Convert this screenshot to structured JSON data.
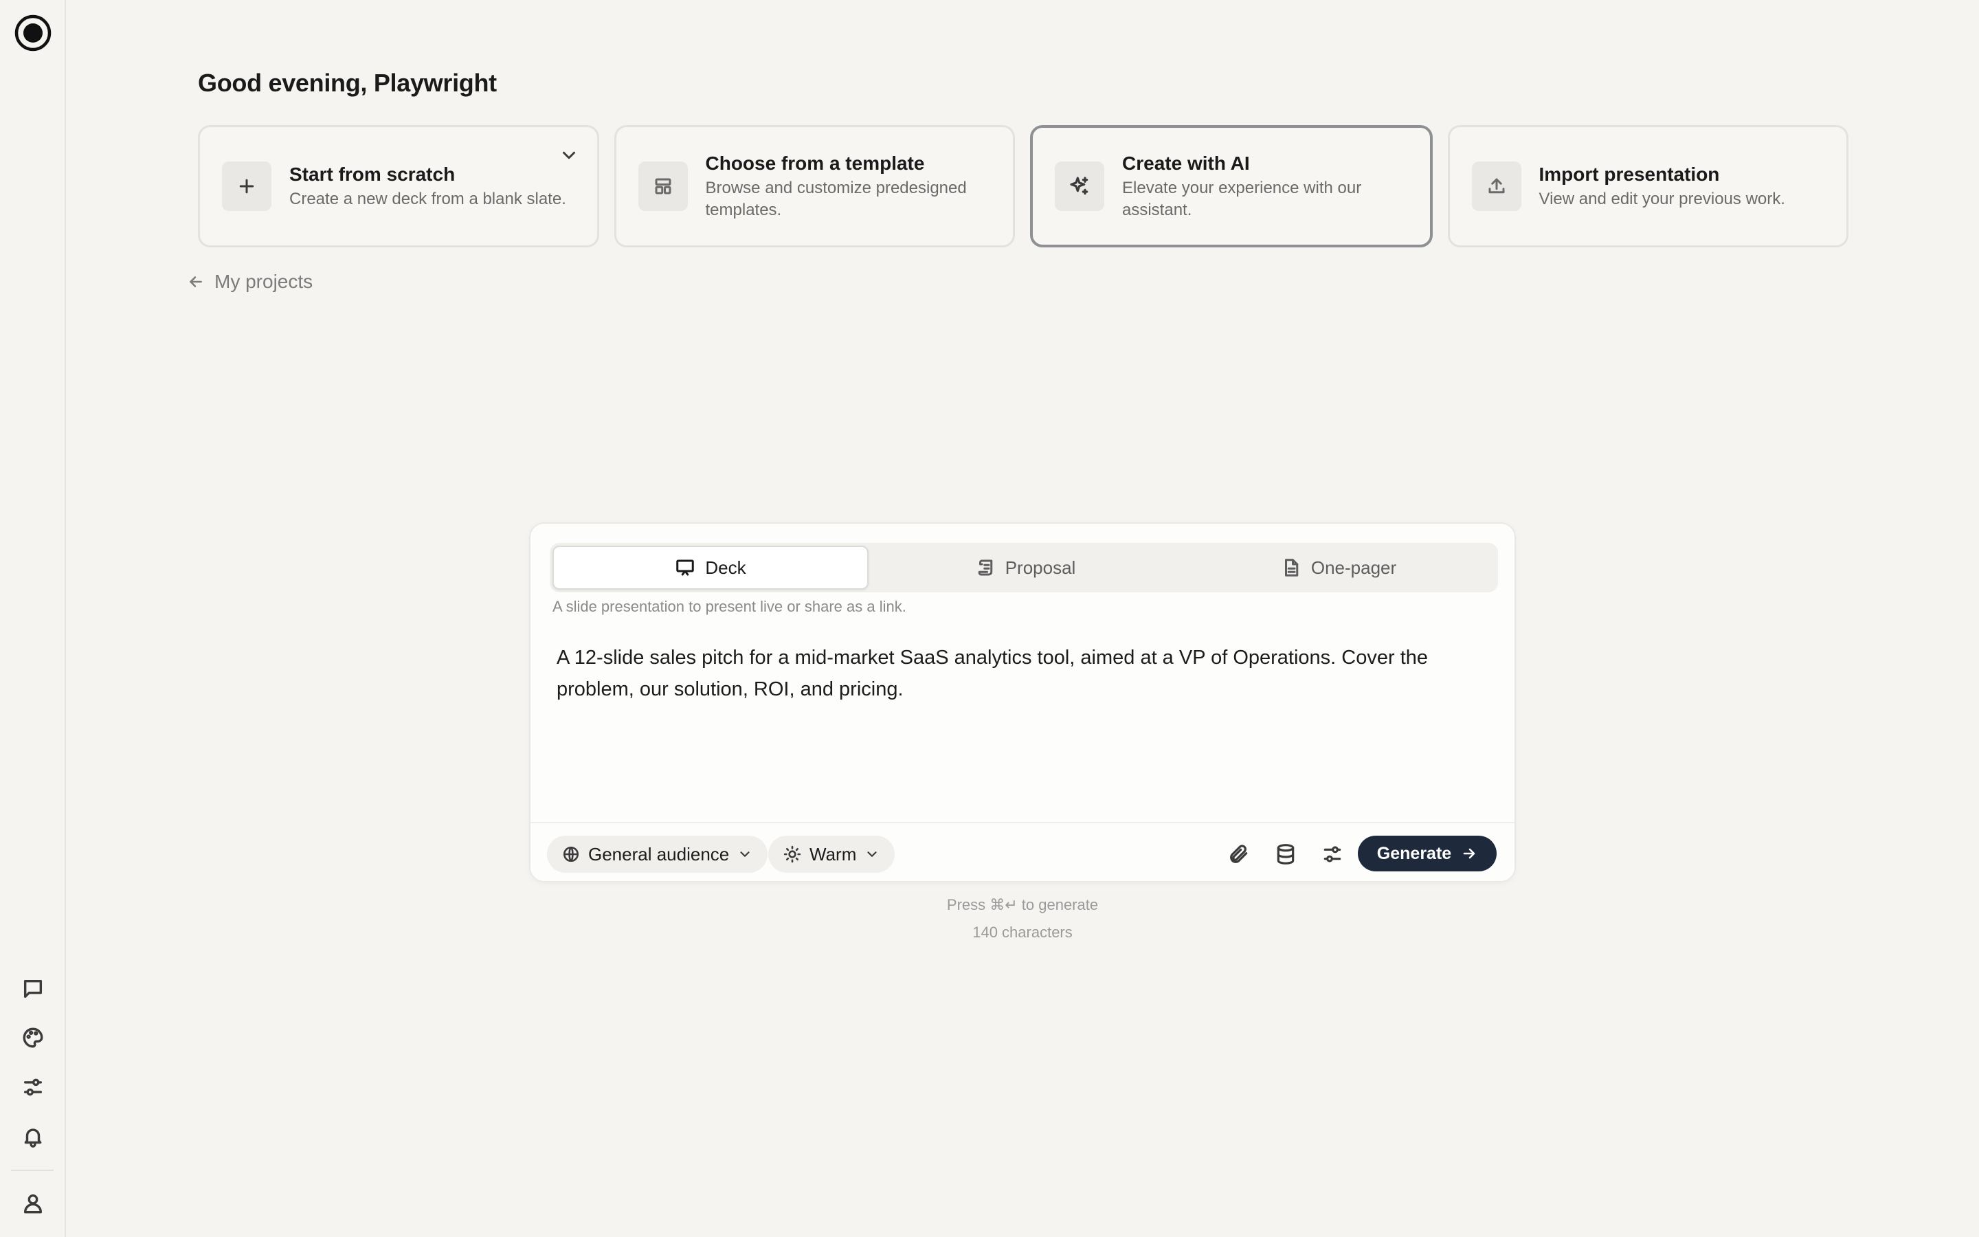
{
  "greeting": "Good evening, Playwright",
  "cards": [
    {
      "title": "Start from scratch",
      "desc": "Create a new deck from a blank slate.",
      "icon": "plus-icon"
    },
    {
      "title": "Choose from a template",
      "desc": "Browse and customize predesigned templates.",
      "icon": "template-icon"
    },
    {
      "title": "Create with AI",
      "desc": "Elevate your experience with our assistant.",
      "icon": "sparkle-icon",
      "selected": true
    },
    {
      "title": "Import presentation",
      "desc": "View and edit your previous work.",
      "icon": "upload-icon"
    }
  ],
  "back_link": "My projects",
  "composer": {
    "tabs": [
      {
        "label": "Deck",
        "icon": "presentation-icon",
        "active": true
      },
      {
        "label": "Proposal",
        "icon": "scroll-icon"
      },
      {
        "label": "One-pager",
        "icon": "document-icon"
      }
    ],
    "tab_description": "A slide presentation to present live or share as a link.",
    "prompt": "A 12-slide sales pitch for a mid-market SaaS analytics tool, aimed at a VP of Operations. Cover the problem, our solution, ROI, and pricing.",
    "audience": "General audience",
    "tone": "Warm",
    "generate_label": "Generate"
  },
  "hints": {
    "shortcut": "Press ⌘↵ to generate",
    "count": "140 characters"
  },
  "colors": {
    "background": "#f5f4f1",
    "generate_button": "#1e2a3b",
    "selected_border": "#8f9094"
  }
}
